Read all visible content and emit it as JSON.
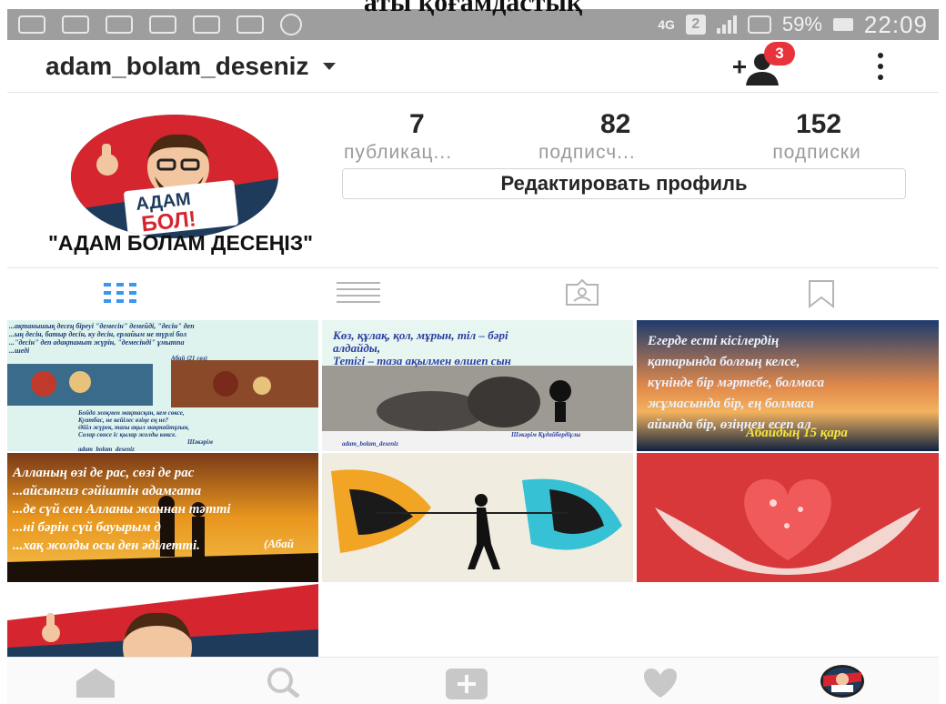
{
  "caption": "аты қоғамдастық",
  "status_bar": {
    "network": "4G",
    "sim_slot": "2",
    "battery": "59%",
    "time": "22:09"
  },
  "header": {
    "username": "adam_bolam_deseniz",
    "notification_count": "3"
  },
  "profile": {
    "stats": [
      {
        "value": "7",
        "label": "публикац..."
      },
      {
        "value": "82",
        "label": "подписч..."
      },
      {
        "value": "152",
        "label": "подписки"
      }
    ],
    "edit_button": "Редактировать профиль",
    "display_name": "\"АДАМ БОЛАМ ДЕСЕҢІЗ\"",
    "avatar_text_1": "АДАМ",
    "avatar_text_2": "БОЛ!"
  },
  "tabs": [
    "grid-icon",
    "list-icon",
    "tagged-icon",
    "saved-icon"
  ],
  "posts": [
    {
      "text_lines": [
        "...ақтанышық десең біреуі \"демесін\" демейді, \"десін\" деп",
        "...ың десін, батыр десін, ку десін, ерлайым не түрлі бол",
        "...\"десін\" деп адақтаныт жүрін, \"демесінді\" ұмытпа",
        "...шеді"
      ],
      "attribution": "Абай (21 сөз)",
      "bottom_lines": [
        "Бойда жоқмен мақтасқан, кем сөксе,",
        "Қуатбас, не кейілес өзіңе ең не?",
        "Әйіл жүрек, тағы ақыл мақтайтұғын,",
        "Солар сөнсе іс қылар жолды көксе."
      ],
      "bottom_attr": "Шәкәрім",
      "handle": "adam_bolam_deseniz"
    },
    {
      "text_lines": [
        "Көз, құлақ, қол, мұрын, тіл – бәрі",
        "алдайды,",
        "Тетігі – таза ақылмен өлшеп сын"
      ],
      "attribution": "Шәкәрім Құдайбердіұлы",
      "handle": "adam_bolam_deseniz"
    },
    {
      "text_lines": [
        "Егерде есті кісілердің",
        "қатарында болғың келсе,",
        "күнінде бір мәртебе, болмаса",
        "жұмасында бір, ең болмаса",
        "айында бір, өзіңнен есеп ал"
      ],
      "attribution": "Абайдың 15 қара"
    },
    {
      "text_lines": [
        "Алланың өзі де рас, сөзі де рас",
        "...айсынгиз сәйіштін адамгата",
        "...де сүй сен Алланы жаннан тәтті",
        "...ні бәрін сүй бауырым д",
        "...хақ жолды осы ден әділетті."
      ],
      "attribution": "(Абай"
    },
    {
      "text_lines": []
    },
    {
      "text_lines": []
    },
    {
      "text_lines": []
    }
  ],
  "bottom_nav": [
    "home-icon",
    "search-icon",
    "add-post-icon",
    "activity-heart-icon",
    "profile-avatar-icon"
  ]
}
